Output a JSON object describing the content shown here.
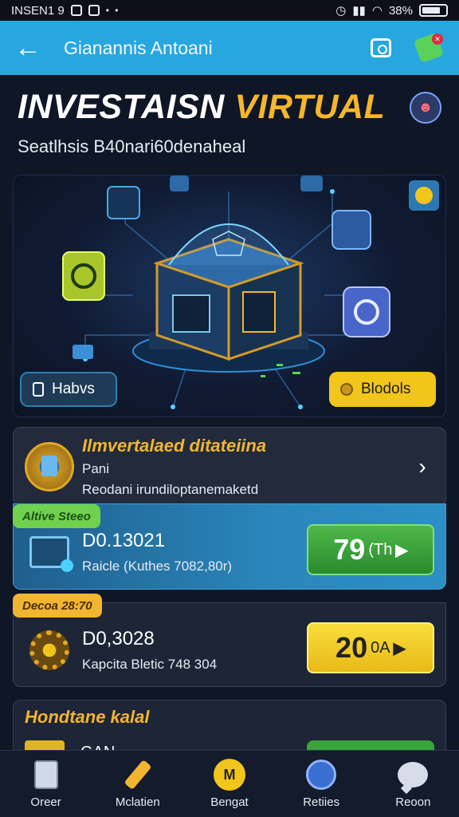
{
  "status": {
    "carrier": "INSEN1 9",
    "battery": "38%"
  },
  "appbar": {
    "title": "Gianannis Antoani"
  },
  "headline": {
    "title_part1": "INVESTAISN",
    "title_part2": "VIRTUAL",
    "subtitle": "Seatlhsis B40nari60denaheal"
  },
  "hero": {
    "left_pill": "Habvs",
    "right_pill": "Blodols",
    "left_pill_icon": "document-icon",
    "right_pill_icon": "coin-icon"
  },
  "intro_card": {
    "title": "Ilmvertalaed ditateiina",
    "line1": "Pani",
    "line2": "Reodani irundiloptanemaketd"
  },
  "plans": [
    {
      "tag": "Altive Steeo",
      "value": "D0.13021",
      "detail": "Raicle (Kuthes 7082,80r)",
      "btn_value": "79",
      "btn_unit": "(Th",
      "btn_arrow": "▶",
      "color": "#2a86bb"
    },
    {
      "tag": "Decoa 28:70",
      "value": "D0,3028",
      "detail": "Kapcita Bletic 748 304",
      "btn_value": "20",
      "btn_unit": "0A",
      "btn_arrow": "▶",
      "color": "#f2b531"
    }
  ],
  "partial_card": {
    "title": "Hondtane kalal",
    "value": "GAN"
  },
  "nav": [
    {
      "label": "Oreer",
      "icon": "document-icon"
    },
    {
      "label": "Mclatien",
      "icon": "tools-icon"
    },
    {
      "label": "Bengat",
      "icon": "m-coin-icon"
    },
    {
      "label": "Retiies",
      "icon": "shield-icon"
    },
    {
      "label": "Reoon",
      "icon": "chat-icon"
    }
  ],
  "colors": {
    "appbar": "#26a7e0",
    "accent_gold": "#f2b531",
    "button_green": "#2a8a2d",
    "button_yellow": "#f2c51b",
    "background": "#0f1626"
  }
}
